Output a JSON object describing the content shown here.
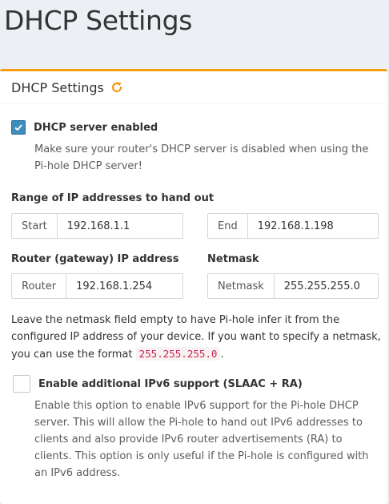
{
  "page": {
    "title": "DHCP Settings"
  },
  "box": {
    "title": "DHCP Settings"
  },
  "dhcp_enabled": {
    "label": "DHCP server enabled",
    "checked": true,
    "help": "Make sure your router's DHCP server is disabled when using the Pi-hole DHCP server!"
  },
  "range": {
    "label": "Range of IP addresses to hand out",
    "start_label": "Start",
    "start_value": "192.168.1.1",
    "end_label": "End",
    "end_value": "192.168.1.198"
  },
  "router": {
    "label": "Router (gateway) IP address",
    "addon": "Router",
    "value": "192.168.1.254"
  },
  "netmask": {
    "label": "Netmask",
    "addon": "Netmask",
    "value": "255.255.255.0",
    "help_before": "Leave the netmask field empty to have Pi-hole infer it from the configured IP address of your device. If you want to specify a netmask, you can use the format ",
    "help_code": "255.255.255.0",
    "help_after": "."
  },
  "ipv6": {
    "label": "Enable additional IPv6 support (SLAAC + RA)",
    "checked": false,
    "help": "Enable this option to enable IPv6 support for the Pi-hole DHCP server. This will allow the Pi-hole to hand out IPv6 addresses to clients and also provide IPv6 router advertisements (RA) to clients. This option is only useful if the Pi-hole is configured with an IPv6 address."
  },
  "colors": {
    "accent": "#f39c12",
    "checkbox": "#3c8dbc",
    "code": "#c7254e"
  }
}
